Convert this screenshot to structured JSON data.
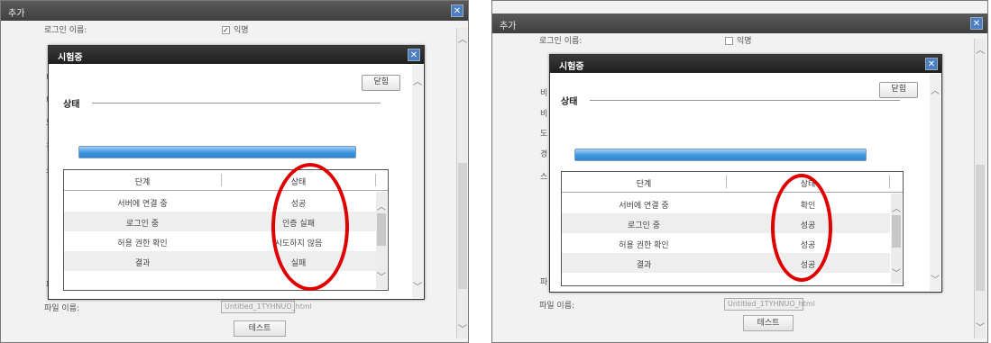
{
  "left": {
    "outer_title": "추가",
    "bg": {
      "login_name_label": "로그인 이름:",
      "anonymous_label": "익명",
      "anonymous_checked": true,
      "side_letters": [
        "비",
        "비",
        "도",
        "경",
        "스"
      ],
      "bottom_letter": "파",
      "file_name_label": "파일 이름:",
      "file_name_value": "Untitled_1TYHNUO_html",
      "test_button": "테스트"
    },
    "dialog": {
      "title": "시험중",
      "close_label": "닫힘",
      "status_header": "상태",
      "progress": 1.0,
      "columns": [
        "단계",
        "상태"
      ],
      "rows": [
        {
          "step": "서버에 연결 중",
          "status": "성공"
        },
        {
          "step": "로그인 중",
          "status": "인증 실패"
        },
        {
          "step": "허용 권한 확인",
          "status": "시도하지 않음"
        },
        {
          "step": "결과",
          "status": "실패"
        }
      ]
    }
  },
  "right": {
    "outer_title": "추가",
    "bg": {
      "login_name_label": "로그인 이름:",
      "anonymous_label": "익명",
      "anonymous_checked": false,
      "side_letters": [
        "비",
        "비",
        "도",
        "경",
        "스"
      ],
      "bottom_letter": "파",
      "file_name_label": "파일 이름:",
      "file_name_value": "Untitled_1TYHNUO_html",
      "test_button": "테스트"
    },
    "dialog": {
      "title": "시험중",
      "close_label": "닫힘",
      "status_header": "상태",
      "progress": 1.0,
      "columns": [
        "단계",
        "상태"
      ],
      "rows": [
        {
          "step": "서버에 연결 중",
          "status": "확인"
        },
        {
          "step": "로그인 중",
          "status": "성공"
        },
        {
          "step": "허용 권한 확인",
          "status": "성공"
        },
        {
          "step": "결과",
          "status": "성공"
        }
      ]
    }
  },
  "colors": {
    "highlight_circle": "#e00000",
    "progress_fill": "#3c95dc",
    "title_bar": "#3f3f3f"
  }
}
